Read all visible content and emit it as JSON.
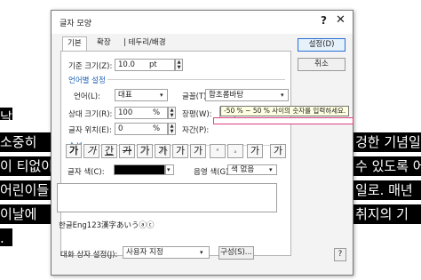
{
  "background_doc": {
    "lines": [
      "날",
      "소중히",
      "이 티없이",
      "어린이들",
      "이날에",
      ".",
      "겅한 기념일",
      "수 있도록 어",
      "일로. 매년",
      "취지의 기"
    ]
  },
  "dialog": {
    "title": "글자 모양",
    "help_label": "?",
    "close_label": "✕",
    "tabs": [
      "기본",
      "확장",
      "테두리/배경"
    ],
    "basic": {
      "size_label": "기준 크기(Z):",
      "size_value": "10.0",
      "size_unit": "pt",
      "lang_section": "언어별 설정",
      "lang_label": "언어(L):",
      "lang_value": "대표",
      "font_label": "글꼴(T):",
      "font_value": "함초롬바탕",
      "ratio_label": "상대 크기(R):",
      "ratio_value": "100",
      "ratio_unit": "%",
      "spacing_label": "장평(W):",
      "spacing_value": "100",
      "pos_label": "글자 위치(E):",
      "pos_value": "0",
      "pos_unit": "%",
      "kerning_label": "자간(P):",
      "kerning_value": "",
      "attr_section": "속성",
      "attr_buttons": [
        "가",
        "가",
        "간",
        "가",
        "가",
        "가",
        "가",
        "가",
        "가",
        "가"
      ],
      "color_label": "글자 색(C):",
      "shade_label": "음영 색(G):",
      "shade_value": "색 없음",
      "preview_text": "한글Eng123漢字あいうⓐⓒ"
    },
    "buttons": {
      "ok": "설정(D)",
      "cancel": "취소",
      "help": "?",
      "compose": "구성(S)..."
    },
    "footer": {
      "label": "대화 상자 설정(J):",
      "value": "사용자 지정"
    },
    "tooltip": "-50 % ~ 50 % 사이의 숫자를 입력하세요."
  }
}
